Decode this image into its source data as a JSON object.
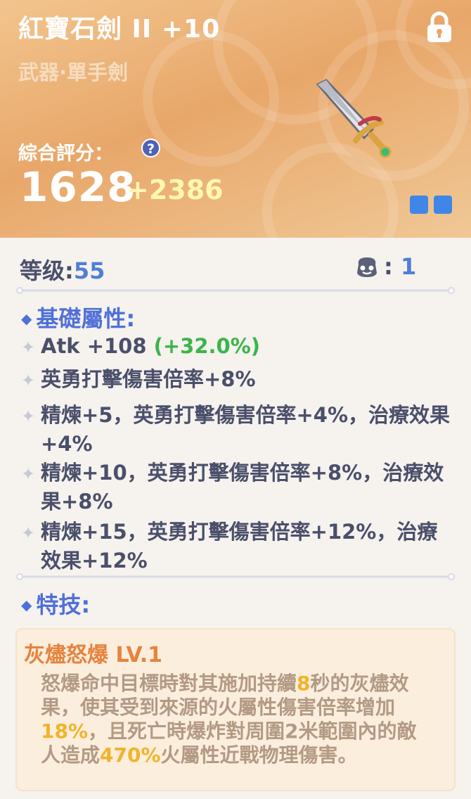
{
  "header": {
    "title": "紅寶石劍 II +10",
    "subtitle": "武器·單手劍",
    "score_label": "綜合評分：",
    "help_glyph": "?",
    "score": "1628",
    "score_bonus": "+2386",
    "lock_icon": "lock-icon",
    "weapon_icon": "sword-icon",
    "accent": "#3f86e8"
  },
  "info": {
    "level_label": "等级:",
    "level_value": "55",
    "upgrade_icon": "upgrade-stone-icon",
    "upgrade_sep": ":",
    "upgrade_value": "1"
  },
  "basic": {
    "heading": "基礎屬性:",
    "atk_text": "Atk +108 ",
    "atk_bonus": "(+32.0%)",
    "lines": [
      "英勇打擊傷害倍率+8%",
      "精煉+5，英勇打擊傷害倍率+4%，治療效果+4%",
      "精煉+10，英勇打擊傷害倍率+8%，治療效果+8%",
      "精煉+15，英勇打擊傷害倍率+12%，治療效果+12%"
    ]
  },
  "skill": {
    "heading": "特技:",
    "name": "灰燼怒爆 LV.1",
    "desc_1": "怒爆命中目標時對其施加持續",
    "hl_1": "8",
    "desc_2": "秒的灰燼效果，使其受到來源的火屬性傷害倍率增加",
    "hl_2": "18%",
    "desc_3": "，且死亡時爆炸對周圍2米範圍內的敵人造成",
    "hl_3": "470%",
    "desc_4": "火屬性近戰物理傷害。"
  }
}
